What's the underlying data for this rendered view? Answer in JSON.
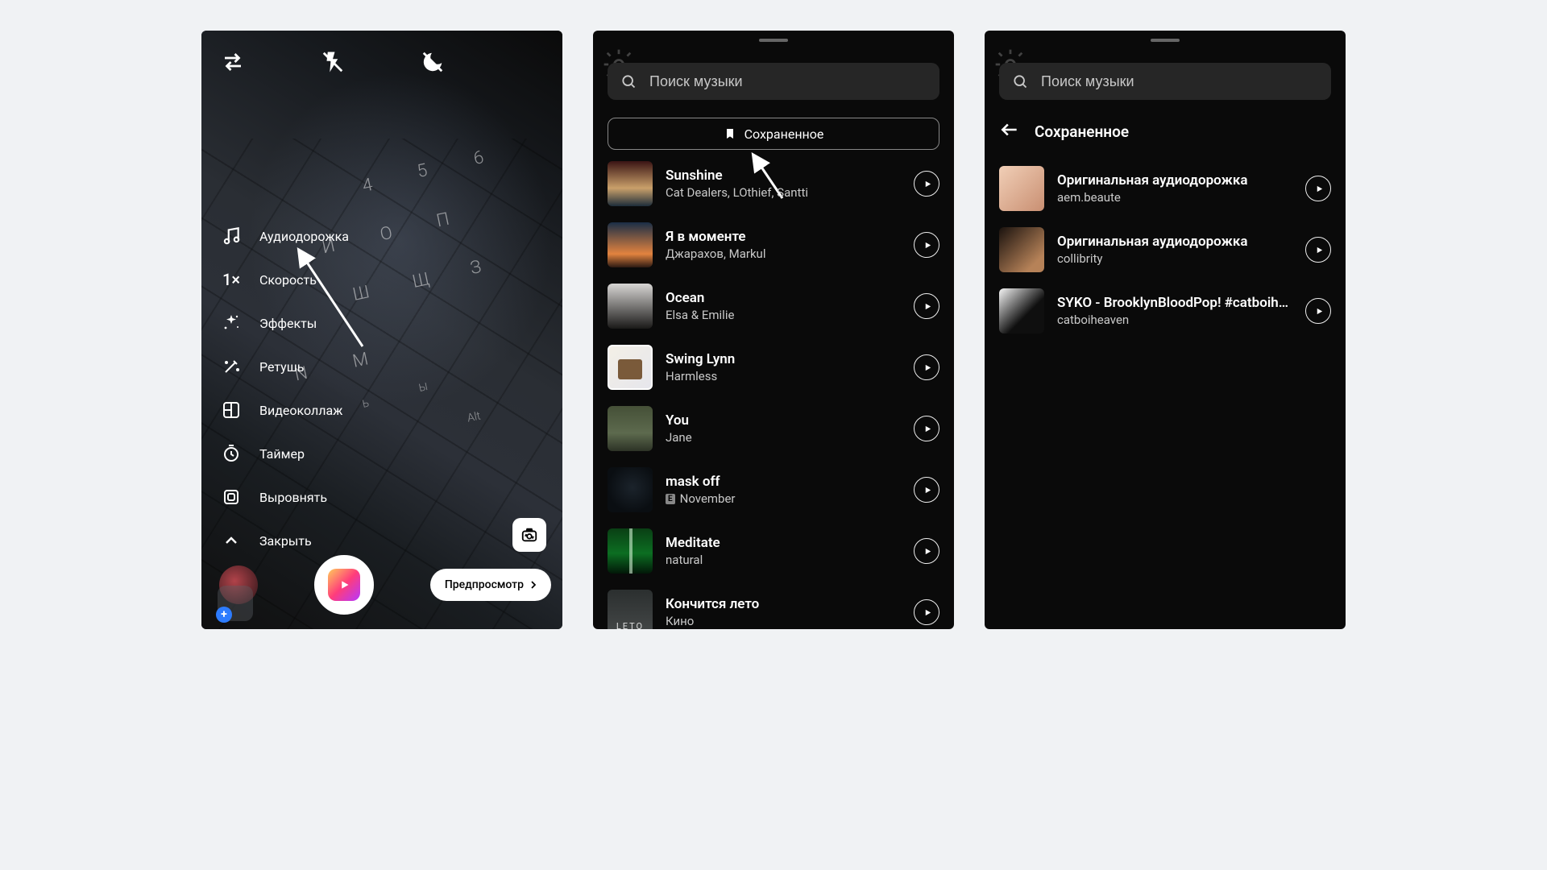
{
  "screen1": {
    "tools": [
      {
        "label": "Аудиодорожка"
      },
      {
        "label": "Скорость"
      },
      {
        "label": "Эффекты"
      },
      {
        "label": "Ретушь"
      },
      {
        "label": "Видеоколлаж"
      },
      {
        "label": "Таймер"
      },
      {
        "label": "Выровнять"
      },
      {
        "label": "Закрыть"
      }
    ],
    "speed_label": "1×",
    "preview_button": "Предпросмотр"
  },
  "screen2": {
    "search_placeholder": "Поиск музыки",
    "saved_button": "Сохраненное",
    "tracks": [
      {
        "title": "Sunshine",
        "artist": "Cat Dealers, LOthief, Santti",
        "explicit": false
      },
      {
        "title": "Я в моменте",
        "artist": "Джарахов, Markul",
        "explicit": false
      },
      {
        "title": "Ocean",
        "artist": "Elsa & Emilie",
        "explicit": false
      },
      {
        "title": "Swing Lynn",
        "artist": "Harmless",
        "explicit": false
      },
      {
        "title": "You",
        "artist": "Jane",
        "explicit": false
      },
      {
        "title": "mask off",
        "artist": "November",
        "explicit": true
      },
      {
        "title": "Meditate",
        "artist": "natural",
        "explicit": false
      },
      {
        "title": "Кончится лето",
        "artist": "Кино",
        "explicit": false
      }
    ]
  },
  "screen3": {
    "search_placeholder": "Поиск музыки",
    "header_title": "Сохраненное",
    "tracks": [
      {
        "title": "Оригинальная аудиодорожка",
        "artist": "aem.beaute"
      },
      {
        "title": "Оригинальная аудиодорожка",
        "artist": "collibrity"
      },
      {
        "title": "SYKO - BrooklynBloodPop! #catboiheaven",
        "artist": "catboiheaven"
      }
    ]
  }
}
